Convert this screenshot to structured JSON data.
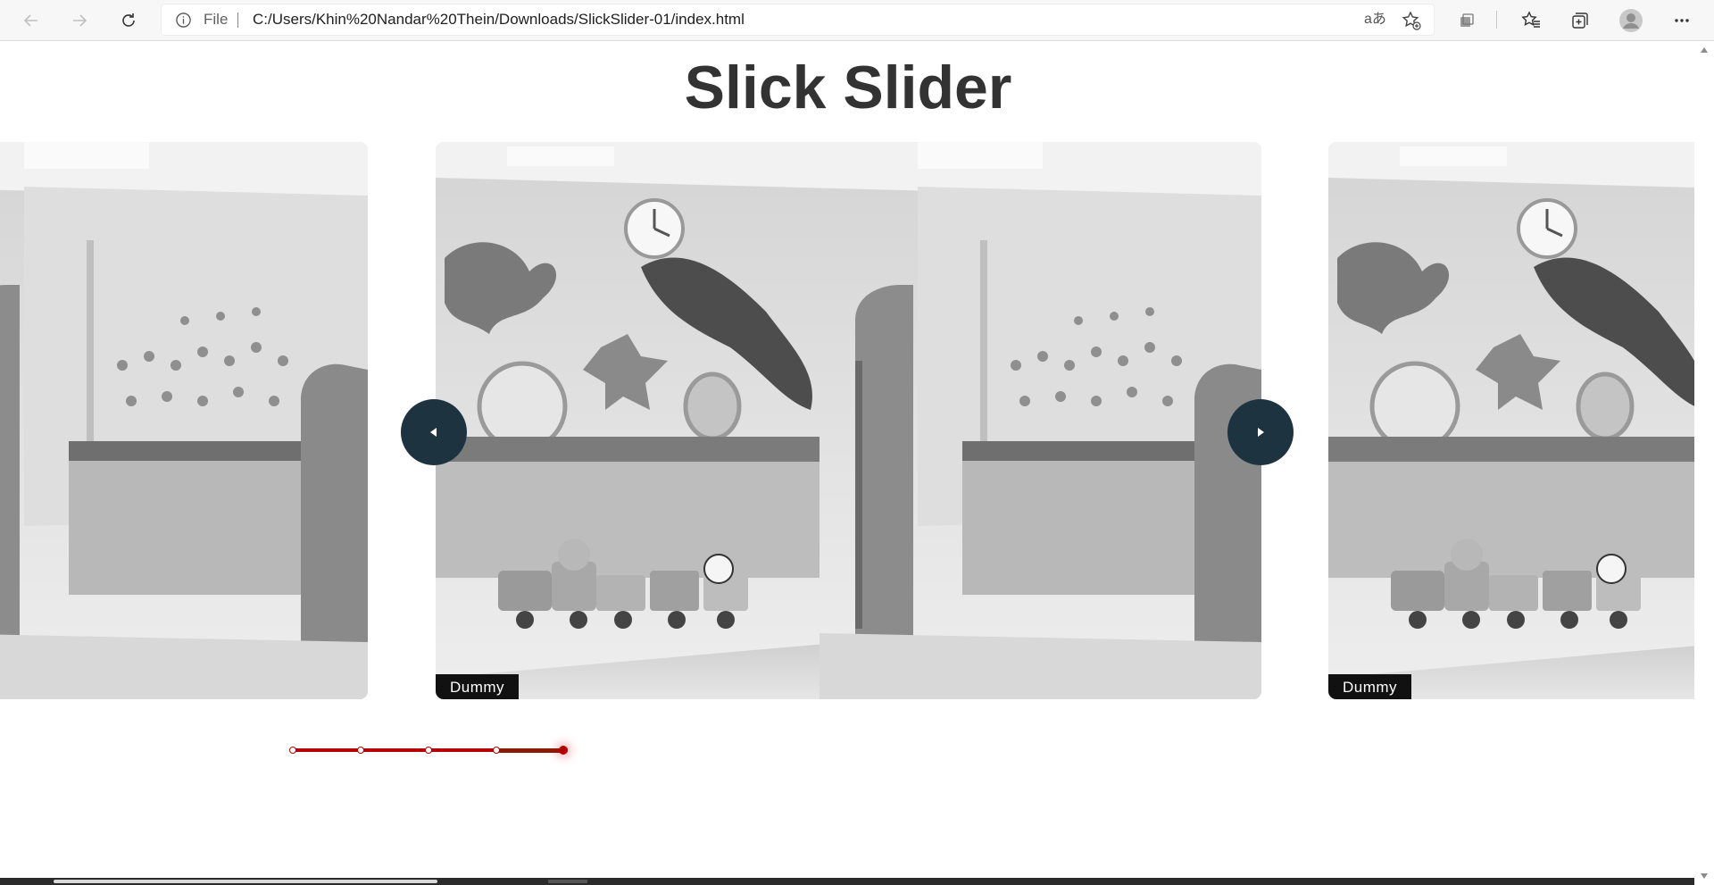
{
  "browser": {
    "address_bar": {
      "scheme_label": "File",
      "url": "C:/Users/Khin%20Nandar%20Thein/Downloads/SlickSlider-01/index.html",
      "read_aloud_label": "aあ"
    },
    "icons": [
      "back-arrow-icon",
      "forward-arrow-icon",
      "reload-icon",
      "info-icon",
      "add-favorite-icon",
      "extensions-icon",
      "favorites-icon",
      "collections-icon",
      "profile-icon",
      "more-icon"
    ]
  },
  "page": {
    "title": "Slick Slider",
    "slides": [
      {
        "position": "previous",
        "caption": ""
      },
      {
        "position": "current",
        "caption": "Dummy"
      },
      {
        "position": "next",
        "caption": "Dummy"
      }
    ],
    "navigation": {
      "prev_icon": "triangle-left-icon",
      "next_icon": "triangle-right-icon",
      "arrow_color": "#1d3340"
    },
    "pagination": {
      "total": 5,
      "active_index": 4,
      "color": "#b40000"
    }
  }
}
